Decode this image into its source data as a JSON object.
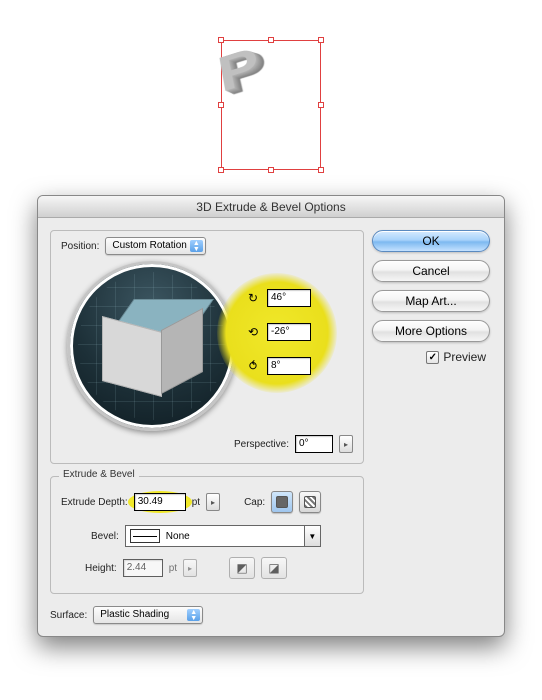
{
  "dialog": {
    "title": "3D Extrude & Bevel Options",
    "position_label": "Position:",
    "position_value": "Custom Rotation",
    "rotation": {
      "x": "46°",
      "y": "-26°",
      "z": "8°"
    },
    "perspective_label": "Perspective:",
    "perspective_value": "0°",
    "extrude_group": "Extrude & Bevel",
    "extrude_depth_label": "Extrude Depth:",
    "extrude_depth_value": "30.49",
    "extrude_depth_unit": "pt",
    "cap_label": "Cap:",
    "bevel_label": "Bevel:",
    "bevel_value": "None",
    "height_label": "Height:",
    "height_value": "2.44",
    "height_unit": "pt",
    "surface_label": "Surface:",
    "surface_value": "Plastic Shading",
    "buttons": {
      "ok": "OK",
      "cancel": "Cancel",
      "map_art": "Map Art...",
      "more_options": "More Options"
    },
    "preview_label": "Preview",
    "preview_checked": true
  }
}
